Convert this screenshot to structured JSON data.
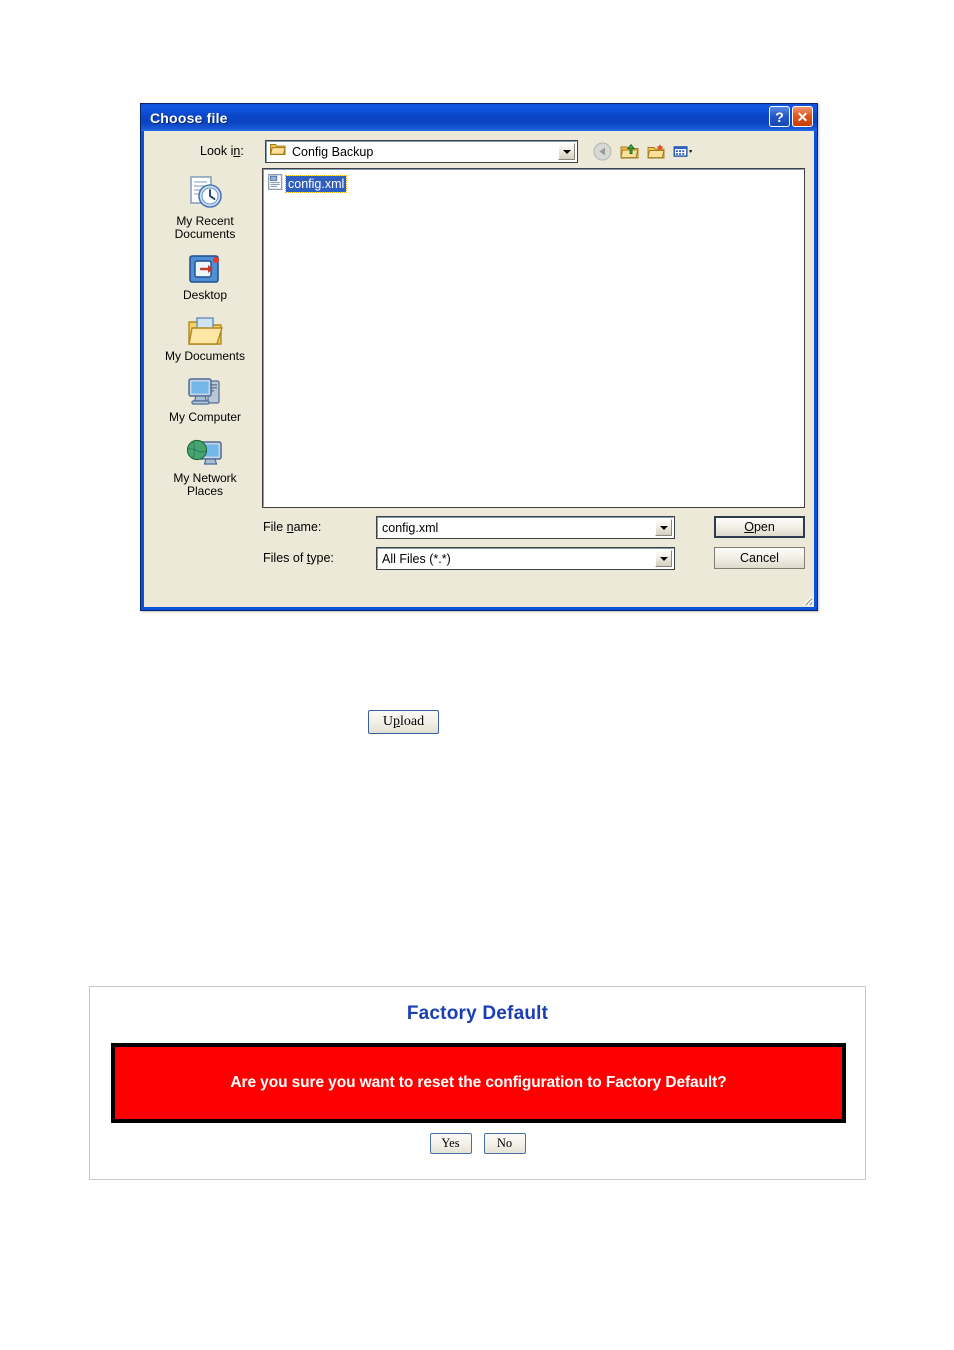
{
  "dialog": {
    "title": "Choose file",
    "titlebar_buttons": [
      {
        "name": "help-button",
        "glyph": "?"
      },
      {
        "name": "close-button",
        "glyph": "✕"
      }
    ],
    "lookin": {
      "label": "Look in:",
      "value": "Config Backup",
      "icon": "open-folder-icon"
    },
    "toolbar": [
      {
        "name": "back-button",
        "icon": "back-arrow-icon",
        "enabled": false
      },
      {
        "name": "up-one-level-button",
        "icon": "up-folder-icon",
        "enabled": true
      },
      {
        "name": "new-folder-button",
        "icon": "new-folder-icon",
        "enabled": true
      },
      {
        "name": "views-button",
        "icon": "views-icon",
        "enabled": true
      }
    ],
    "places": [
      {
        "label": "My Recent\nDocuments",
        "icon": "recent-documents-icon"
      },
      {
        "label": "Desktop",
        "icon": "desktop-icon"
      },
      {
        "label": "My Documents",
        "icon": "my-documents-icon"
      },
      {
        "label": "My Computer",
        "icon": "my-computer-icon"
      },
      {
        "label": "My Network\nPlaces",
        "icon": "my-network-places-icon"
      }
    ],
    "files": [
      {
        "name": "config.xml",
        "icon": "xml-file-icon",
        "selected": true
      }
    ],
    "filename_field": {
      "label": "File name:",
      "label_prefix": "File ",
      "label_accel": "n",
      "label_suffix": "ame:",
      "value": "config.xml"
    },
    "filetype_field": {
      "label": "Files of type:",
      "label_prefix": "Files of ",
      "label_accel": "t",
      "label_suffix": "ype:",
      "value": "All Files (*.*)"
    },
    "open_button": {
      "prefix": "",
      "accel": "O",
      "suffix": "pen"
    },
    "cancel_button": {
      "label": "Cancel"
    }
  },
  "upload": {
    "prefix": "U",
    "accel": "p",
    "suffix": "load"
  },
  "factory_default": {
    "title": "Factory Default",
    "warning": "Are you sure you want to reset the configuration to Factory Default?",
    "yes_label": "Yes",
    "no_label": "No",
    "colors": {
      "title": "#1a3fb5",
      "warning_background": "#fe0000",
      "warning_text": "#ffffff",
      "warning_border": "#000000"
    }
  }
}
